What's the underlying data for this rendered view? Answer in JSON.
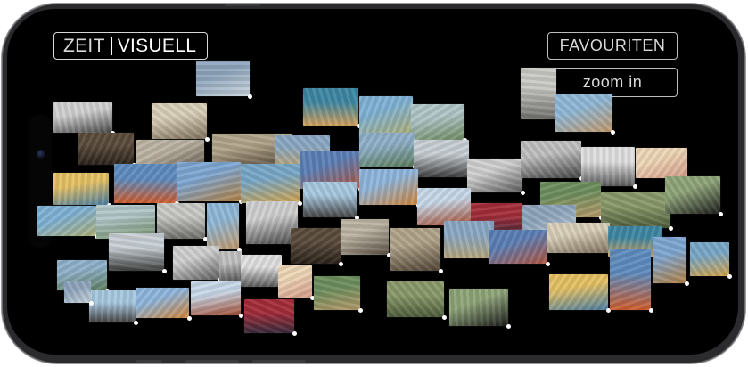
{
  "header": {
    "logo_left": "ZEIT",
    "logo_right": "VISUELL"
  },
  "buttons": {
    "favourites": "FAVOURITEN",
    "zoom": "zoom in"
  },
  "postcards": [
    {
      "name": "airplane",
      "top": "#8fa6bd",
      "bottom": "#c9d4dc"
    },
    {
      "name": "monument-square",
      "top": "#d9cfb8",
      "bottom": "#7f725e"
    },
    {
      "name": "palm-promenade",
      "top": "#3f87a3",
      "bottom": "#d2a25c"
    },
    {
      "name": "seaside-villas",
      "top": "#7fb2d6",
      "bottom": "#aeb078"
    },
    {
      "name": "harbour-boats",
      "top": "#b0c6c8",
      "bottom": "#6f8b62"
    },
    {
      "name": "rock-arch",
      "top": "#c9c9c6",
      "bottom": "#6e6e6a"
    },
    {
      "name": "beach-umbrellas",
      "top": "#8fb8d8",
      "bottom": "#c39a6b"
    },
    {
      "name": "old-photos-grid",
      "top": "#d0d0d0",
      "bottom": "#474747"
    },
    {
      "name": "interior-hall",
      "top": "#5a4b3b",
      "bottom": "#2a221a"
    },
    {
      "name": "old-street",
      "top": "#bcb3a2",
      "bottom": "#5b5245"
    },
    {
      "name": "gothic-church",
      "top": "#b2a48a",
      "bottom": "#4e4335"
    },
    {
      "name": "bavarian-town",
      "top": "#8ba8c4",
      "bottom": "#b6a67d"
    },
    {
      "name": "colorful-houses",
      "top": "#5b7fb6",
      "bottom": "#b05640"
    },
    {
      "name": "lake-mountains",
      "top": "#8fb0c9",
      "bottom": "#5b7c5c"
    },
    {
      "name": "alpine-peaks",
      "top": "#c8cfd4",
      "bottom": "#3d3d3d"
    },
    {
      "name": "modern-building",
      "top": "#d0d0d0",
      "bottom": "#5c5c5c"
    },
    {
      "name": "station",
      "top": "#bfbfbf",
      "bottom": "#434343"
    },
    {
      "name": "leaning-tower",
      "top": "#e0e0e0",
      "bottom": "#5a5a5a"
    },
    {
      "name": "fashion-figures",
      "top": "#efd7b7",
      "bottom": "#d49a86"
    },
    {
      "name": "palm-garden",
      "top": "#6d8e5d",
      "bottom": "#b69a6a"
    },
    {
      "name": "elephant-park",
      "top": "#8a9a6a",
      "bottom": "#4d5b3a"
    },
    {
      "name": "black-bear",
      "top": "#8fa57a",
      "bottom": "#1c1c1a"
    },
    {
      "name": "poster-au-maroc",
      "top": "#e5c164",
      "bottom": "#4c7fa5"
    },
    {
      "name": "mount-fuji",
      "top": "#5d8cc0",
      "bottom": "#d05d2e"
    },
    {
      "name": "desert-camels",
      "top": "#7ea7d3",
      "bottom": "#b38142"
    },
    {
      "name": "flying-boat",
      "top": "#78a8c9",
      "bottom": "#d3a44a"
    },
    {
      "name": "cable-car",
      "top": "#a7c8df",
      "bottom": "#444"
    },
    {
      "name": "tram-city",
      "top": "#8fb6dc",
      "bottom": "#d1863d"
    },
    {
      "name": "red-tower",
      "top": "#c8d8e8",
      "bottom": "#a24a2f"
    },
    {
      "name": "dome-hall",
      "top": "#a42c39",
      "bottom": "#3a2a3a"
    }
  ],
  "colors": {
    "screen": "#000000",
    "frame": "#2b2b2d",
    "ui_text": "#ffffff",
    "ui_border": "#cfcfcf"
  }
}
